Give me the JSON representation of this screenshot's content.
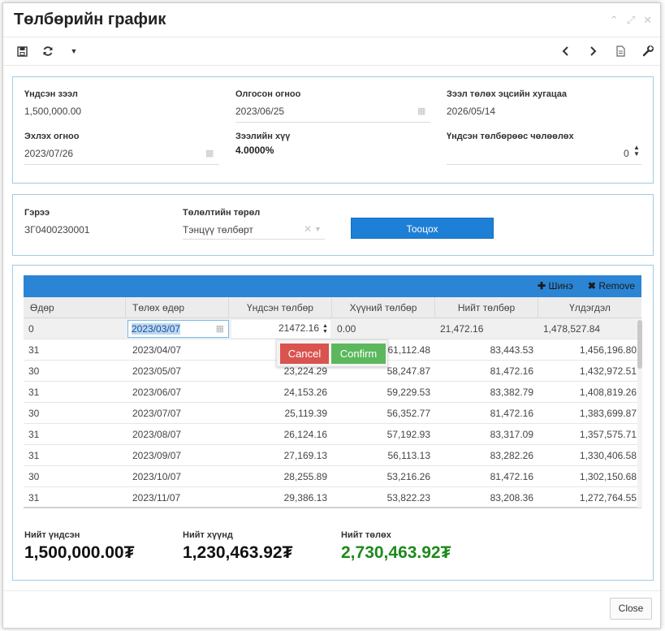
{
  "dialog": {
    "title": "Төлбөрийн график"
  },
  "loan": {
    "principal_label": "Үндсэн зээл",
    "principal_value": "1,500,000.00",
    "issue_date_label": "Олгосон огноо",
    "issue_date_value": "2023/06/25",
    "term_label": "Зээл төлөх эцсийн хугацаа",
    "term_value": "2026/05/14",
    "start_date_label": "Эхлэх огноо",
    "start_date_value": "2023/07/26",
    "rate_label": "Зээлийн хүү",
    "rate_value": "4.0000%",
    "grace_label": "Үндсэн төлбөрөөс чөлөөлөх",
    "grace_value": "0"
  },
  "contract": {
    "contract_label": "Гэрээ",
    "contract_value": "ЗГ0400230001",
    "type_label": "Төлөлтийн төрөл",
    "type_value": "Тэнцүү төлбөрт",
    "calc_button": "Тооцох"
  },
  "table": {
    "add_label": "Шинэ",
    "remove_label": "Remove",
    "headers": [
      "Өдөр",
      "Төлөх өдөр",
      "Үндсэн төлбөр",
      "Хүүний төлбөр",
      "Нийт төлбөр",
      "Үлдэгдэл"
    ],
    "edit_row": {
      "days": "0",
      "date": "2023/03/07",
      "principal": "21472.16",
      "interest": "0.00",
      "total": "21,472.16",
      "balance": "1,478,527.84"
    },
    "rows": [
      [
        "31",
        "2023/04/07",
        "",
        "61,112.48",
        "83,443.53",
        "1,456,196.80"
      ],
      [
        "30",
        "2023/05/07",
        "23,224.29",
        "58,247.87",
        "81,472.16",
        "1,432,972.51"
      ],
      [
        "31",
        "2023/06/07",
        "24,153.26",
        "59,229.53",
        "83,382.79",
        "1,408,819.26"
      ],
      [
        "30",
        "2023/07/07",
        "25,119.39",
        "56,352.77",
        "81,472.16",
        "1,383,699.87"
      ],
      [
        "31",
        "2023/08/07",
        "26,124.16",
        "57,192.93",
        "83,317.09",
        "1,357,575.71"
      ],
      [
        "31",
        "2023/09/07",
        "27,169.13",
        "56,113.13",
        "83,282.26",
        "1,330,406.58"
      ],
      [
        "30",
        "2023/10/07",
        "28,255.89",
        "53,216.26",
        "81,472.16",
        "1,302,150.68"
      ],
      [
        "31",
        "2023/11/07",
        "29,386.13",
        "53,822.23",
        "83,208.36",
        "1,272,764.55"
      ]
    ],
    "popup": {
      "cancel": "Cancel",
      "confirm": "Confirm"
    }
  },
  "summary": {
    "principal_label": "Нийт үндсэн",
    "principal_value": "1,500,000.00₮",
    "interest_label": "Нийт хүүнд",
    "interest_value": "1,230,463.92₮",
    "total_label": "Нийт төлөх",
    "total_value": "2,730,463.92₮"
  },
  "footer": {
    "close": "Close"
  },
  "colors": {
    "accent": "#2b85d4",
    "cancel": "#d9534f",
    "confirm": "#5cb85c",
    "total_green": "#1e8a1e"
  }
}
